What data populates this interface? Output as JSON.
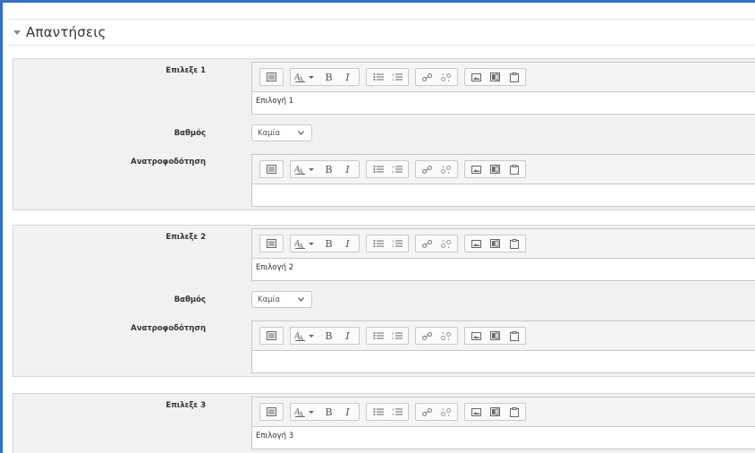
{
  "section": {
    "title": "Απαντήσεις"
  },
  "labels": {
    "grade": "Βαθμός",
    "feedback": "Ανατροφοδότηση"
  },
  "choices": [
    {
      "label": "Επιλεξε 1",
      "answer": "Επιλογή 1",
      "grade": "Καμία",
      "feedback": ""
    },
    {
      "label": "Επιλεξε 2",
      "answer": "Επιλογή 2",
      "grade": "Καμία",
      "feedback": ""
    },
    {
      "label": "Επιλεξε 3",
      "answer": "Επιλογή 3"
    }
  ],
  "toolbar": {
    "bold": "B",
    "italic": "I"
  }
}
